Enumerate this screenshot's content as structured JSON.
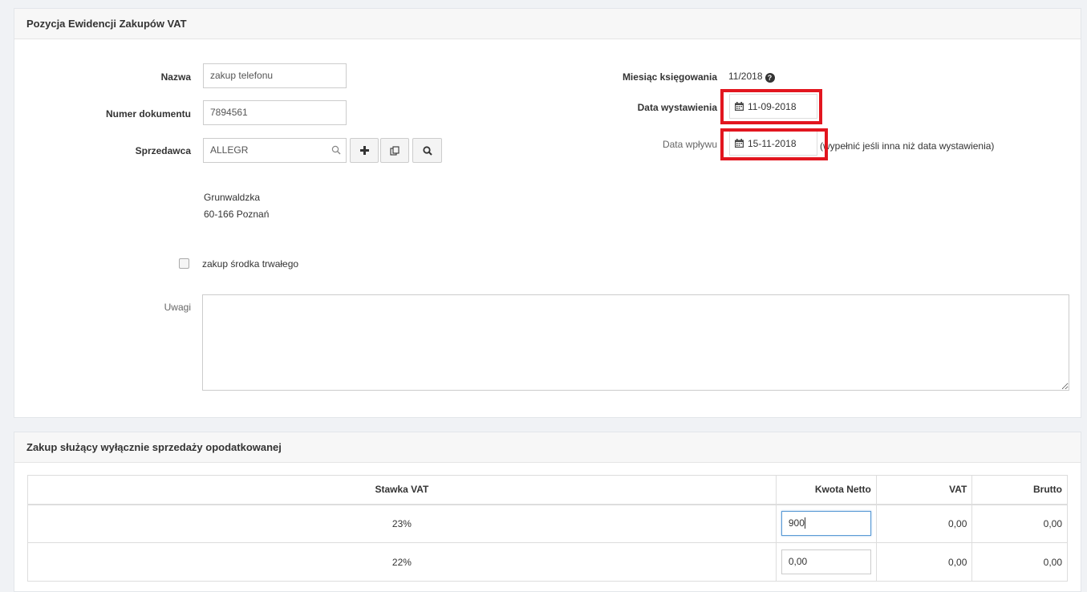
{
  "panel1": {
    "title": "Pozycja Ewidencji Zakupów VAT",
    "nazwa_label": "Nazwa",
    "nazwa_value": "zakup telefonu",
    "numer_label": "Numer dokumentu",
    "numer_value": "7894561",
    "sprzedawca_label": "Sprzedawca",
    "sprzedawca_value": "ALLEGR",
    "address_line1": "Grunwaldzka",
    "address_line2": "60-166 Poznań",
    "checkbox_label": "zakup środka trwałego",
    "uwagi_label": "Uwagi",
    "miesiac_label": "Miesiąc księgowania",
    "miesiac_value": "11/2018",
    "data_wyst_label": "Data wystawienia",
    "data_wyst_value": "11-09-2018",
    "data_wplywu_label": "Data wpływu",
    "data_wplywu_value": "15-11-2018",
    "data_wplywu_hint": "(wypełnić jeśli inna niż data wystawienia)"
  },
  "panel2": {
    "title": "Zakup służący wyłącznie sprzedaży opodatkowanej",
    "columns": [
      "Stawka VAT",
      "Kwota Netto",
      "VAT",
      "Brutto"
    ],
    "rows": [
      {
        "stawka": "23%",
        "netto": "900",
        "vat": "0,00",
        "brutto": "0,00"
      },
      {
        "stawka": "22%",
        "netto": "0,00",
        "vat": "0,00",
        "brutto": "0,00"
      }
    ]
  },
  "icons": {
    "search": "search-icon",
    "plus": "plus-icon",
    "copy": "copy-icon",
    "magnifier": "magnifier-icon",
    "calendar": "calendar-icon",
    "question": "question-circle-icon"
  },
  "colors": {
    "highlight": "#e2161f",
    "focus_border": "#5b9bd5"
  }
}
